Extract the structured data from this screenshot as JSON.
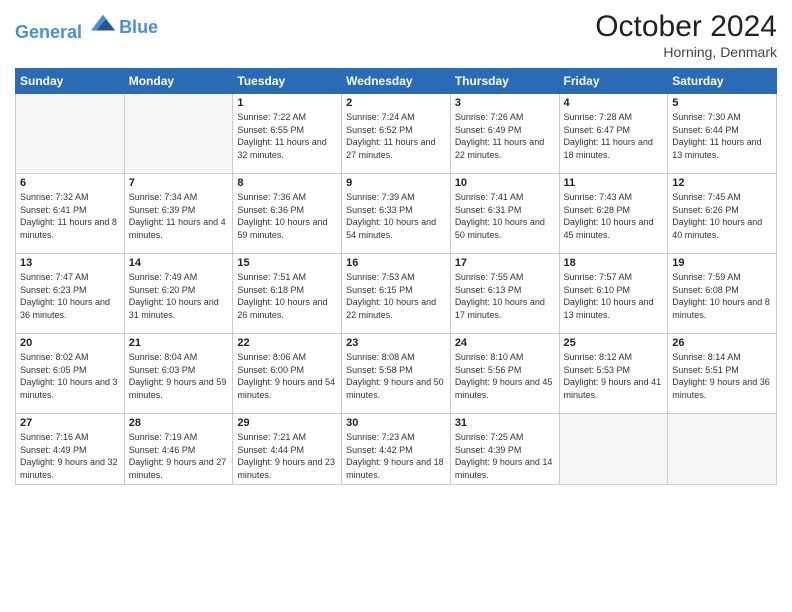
{
  "header": {
    "logo_line1": "General",
    "logo_line2": "Blue",
    "month": "October 2024",
    "location": "Horning, Denmark"
  },
  "weekdays": [
    "Sunday",
    "Monday",
    "Tuesday",
    "Wednesday",
    "Thursday",
    "Friday",
    "Saturday"
  ],
  "weeks": [
    [
      {
        "day": "",
        "info": ""
      },
      {
        "day": "",
        "info": ""
      },
      {
        "day": "1",
        "info": "Sunrise: 7:22 AM\nSunset: 6:55 PM\nDaylight: 11 hours and 32 minutes."
      },
      {
        "day": "2",
        "info": "Sunrise: 7:24 AM\nSunset: 6:52 PM\nDaylight: 11 hours and 27 minutes."
      },
      {
        "day": "3",
        "info": "Sunrise: 7:26 AM\nSunset: 6:49 PM\nDaylight: 11 hours and 22 minutes."
      },
      {
        "day": "4",
        "info": "Sunrise: 7:28 AM\nSunset: 6:47 PM\nDaylight: 11 hours and 18 minutes."
      },
      {
        "day": "5",
        "info": "Sunrise: 7:30 AM\nSunset: 6:44 PM\nDaylight: 11 hours and 13 minutes."
      }
    ],
    [
      {
        "day": "6",
        "info": "Sunrise: 7:32 AM\nSunset: 6:41 PM\nDaylight: 11 hours and 8 minutes."
      },
      {
        "day": "7",
        "info": "Sunrise: 7:34 AM\nSunset: 6:39 PM\nDaylight: 11 hours and 4 minutes."
      },
      {
        "day": "8",
        "info": "Sunrise: 7:36 AM\nSunset: 6:36 PM\nDaylight: 10 hours and 59 minutes."
      },
      {
        "day": "9",
        "info": "Sunrise: 7:39 AM\nSunset: 6:33 PM\nDaylight: 10 hours and 54 minutes."
      },
      {
        "day": "10",
        "info": "Sunrise: 7:41 AM\nSunset: 6:31 PM\nDaylight: 10 hours and 50 minutes."
      },
      {
        "day": "11",
        "info": "Sunrise: 7:43 AM\nSunset: 6:28 PM\nDaylight: 10 hours and 45 minutes."
      },
      {
        "day": "12",
        "info": "Sunrise: 7:45 AM\nSunset: 6:26 PM\nDaylight: 10 hours and 40 minutes."
      }
    ],
    [
      {
        "day": "13",
        "info": "Sunrise: 7:47 AM\nSunset: 6:23 PM\nDaylight: 10 hours and 36 minutes."
      },
      {
        "day": "14",
        "info": "Sunrise: 7:49 AM\nSunset: 6:20 PM\nDaylight: 10 hours and 31 minutes."
      },
      {
        "day": "15",
        "info": "Sunrise: 7:51 AM\nSunset: 6:18 PM\nDaylight: 10 hours and 26 minutes."
      },
      {
        "day": "16",
        "info": "Sunrise: 7:53 AM\nSunset: 6:15 PM\nDaylight: 10 hours and 22 minutes."
      },
      {
        "day": "17",
        "info": "Sunrise: 7:55 AM\nSunset: 6:13 PM\nDaylight: 10 hours and 17 minutes."
      },
      {
        "day": "18",
        "info": "Sunrise: 7:57 AM\nSunset: 6:10 PM\nDaylight: 10 hours and 13 minutes."
      },
      {
        "day": "19",
        "info": "Sunrise: 7:59 AM\nSunset: 6:08 PM\nDaylight: 10 hours and 8 minutes."
      }
    ],
    [
      {
        "day": "20",
        "info": "Sunrise: 8:02 AM\nSunset: 6:05 PM\nDaylight: 10 hours and 3 minutes."
      },
      {
        "day": "21",
        "info": "Sunrise: 8:04 AM\nSunset: 6:03 PM\nDaylight: 9 hours and 59 minutes."
      },
      {
        "day": "22",
        "info": "Sunrise: 8:06 AM\nSunset: 6:00 PM\nDaylight: 9 hours and 54 minutes."
      },
      {
        "day": "23",
        "info": "Sunrise: 8:08 AM\nSunset: 5:58 PM\nDaylight: 9 hours and 50 minutes."
      },
      {
        "day": "24",
        "info": "Sunrise: 8:10 AM\nSunset: 5:56 PM\nDaylight: 9 hours and 45 minutes."
      },
      {
        "day": "25",
        "info": "Sunrise: 8:12 AM\nSunset: 5:53 PM\nDaylight: 9 hours and 41 minutes."
      },
      {
        "day": "26",
        "info": "Sunrise: 8:14 AM\nSunset: 5:51 PM\nDaylight: 9 hours and 36 minutes."
      }
    ],
    [
      {
        "day": "27",
        "info": "Sunrise: 7:16 AM\nSunset: 4:49 PM\nDaylight: 9 hours and 32 minutes."
      },
      {
        "day": "28",
        "info": "Sunrise: 7:19 AM\nSunset: 4:46 PM\nDaylight: 9 hours and 27 minutes."
      },
      {
        "day": "29",
        "info": "Sunrise: 7:21 AM\nSunset: 4:44 PM\nDaylight: 9 hours and 23 minutes."
      },
      {
        "day": "30",
        "info": "Sunrise: 7:23 AM\nSunset: 4:42 PM\nDaylight: 9 hours and 18 minutes."
      },
      {
        "day": "31",
        "info": "Sunrise: 7:25 AM\nSunset: 4:39 PM\nDaylight: 9 hours and 14 minutes."
      },
      {
        "day": "",
        "info": ""
      },
      {
        "day": "",
        "info": ""
      }
    ]
  ]
}
